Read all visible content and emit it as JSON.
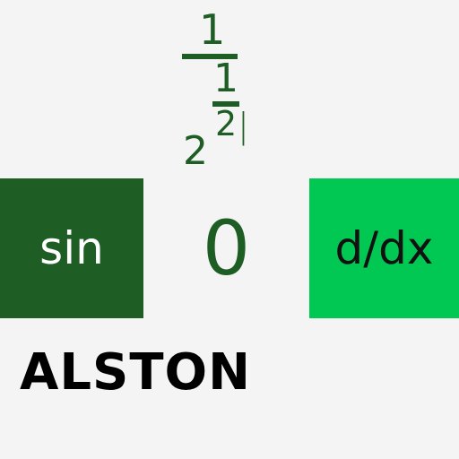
{
  "expression": {
    "top_numerator": "1",
    "inner_numerator": "1",
    "inner_denominator": "2",
    "base": "2",
    "cursor": "|"
  },
  "buttons": {
    "sin_label": "sin",
    "derivative_label": "d/dx"
  },
  "display": {
    "value": "0"
  },
  "brand": {
    "text": "ALSTON"
  },
  "colors": {
    "dark_green": "#1e5e25",
    "bright_green": "#00c853",
    "background": "#f4f4f4"
  }
}
